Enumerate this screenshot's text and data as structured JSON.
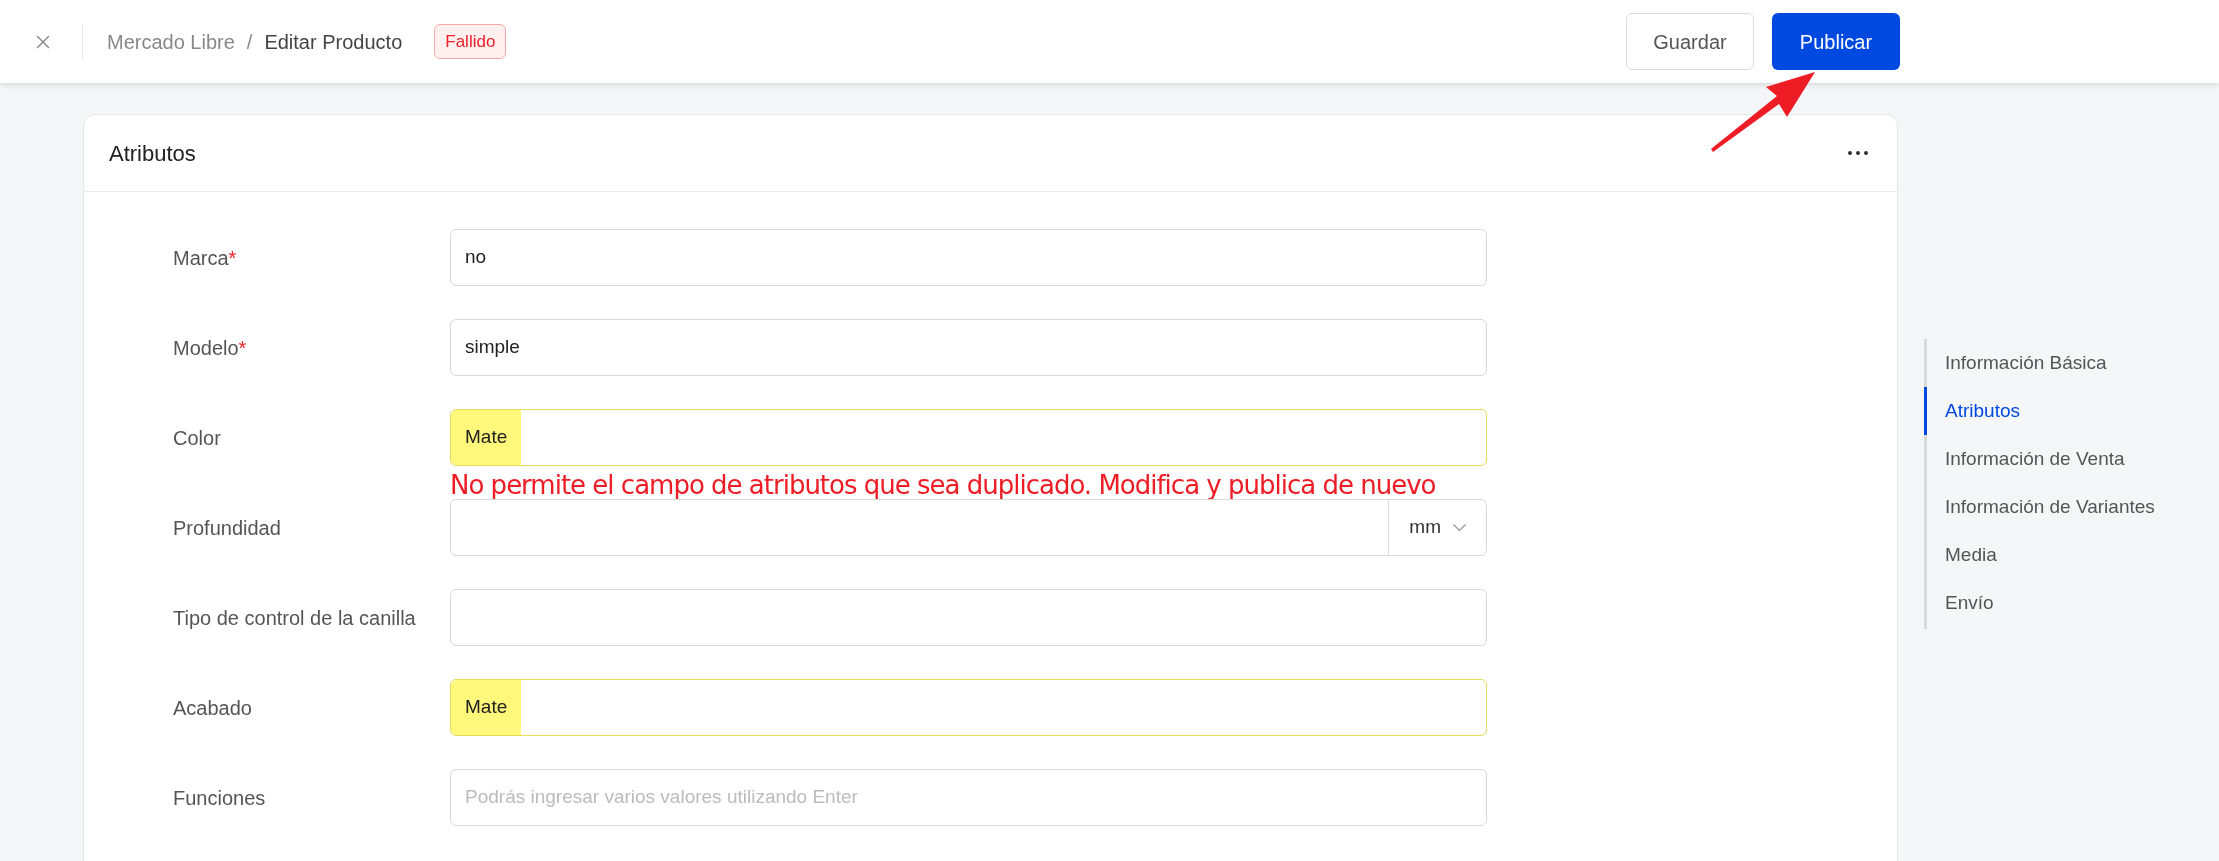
{
  "header": {
    "breadcrumb": [
      "Mercado Libre",
      "Editar Producto"
    ],
    "separator": "/",
    "status_badge": "Fallido",
    "buttons": [
      {
        "label": "Guardar",
        "kind": "secondary"
      },
      {
        "label": "Publicar",
        "kind": "primary"
      }
    ]
  },
  "card": {
    "title": "Atributos",
    "fields": [
      {
        "kind": "text",
        "label": "Marca",
        "required_mark": "*",
        "value": "no",
        "highlighted": false
      },
      {
        "kind": "text",
        "label": "Modelo",
        "required_mark": "*",
        "value": "simple",
        "highlighted": false
      },
      {
        "kind": "text",
        "label": "Color",
        "value": "Mate",
        "highlighted": true,
        "note": "No permite el campo de atributos que sea duplicado. Modifica y publica de nuevo"
      },
      {
        "kind": "unit",
        "label": "Profundidad",
        "unit": "mm"
      },
      {
        "kind": "text",
        "label": "Tipo de control de la canilla"
      },
      {
        "kind": "text",
        "label": "Acabado",
        "value": "Mate",
        "highlighted": true
      },
      {
        "kind": "text",
        "label": "Funciones",
        "placeholder": "Podrás ingresar varios valores utilizando Enter"
      }
    ]
  },
  "section_nav": [
    {
      "label": "Información Básica",
      "selected": false
    },
    {
      "label": "Atributos",
      "selected": true
    },
    {
      "label": "Información de Venta",
      "selected": false
    },
    {
      "label": "Información de Variantes",
      "selected": false
    },
    {
      "label": "Media",
      "selected": false
    },
    {
      "label": "Envío",
      "selected": false
    }
  ]
}
